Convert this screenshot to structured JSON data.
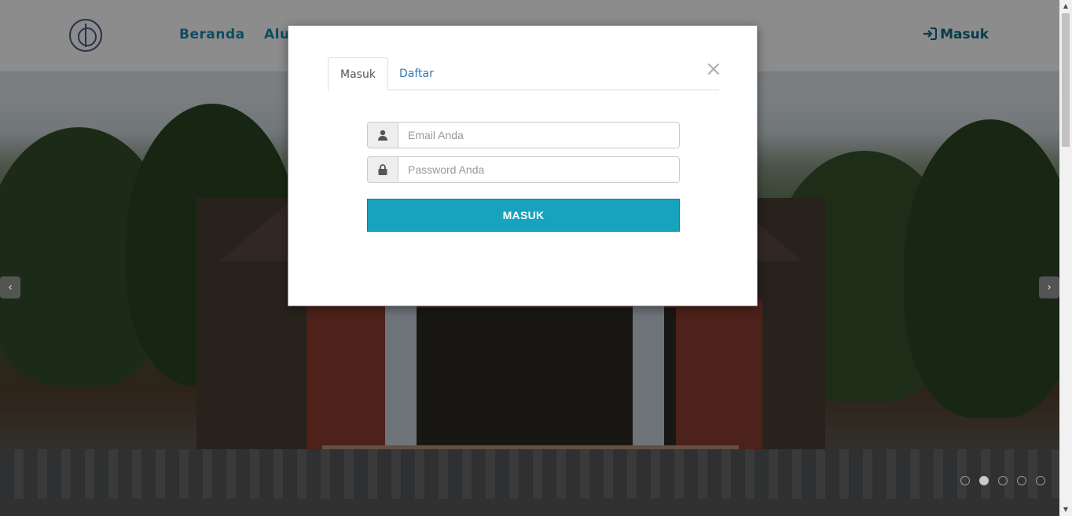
{
  "navbar": {
    "logo_name": "school-logo",
    "links": [
      {
        "label": "Beranda"
      },
      {
        "label": "Alu"
      }
    ],
    "login": {
      "icon": "sign-in-icon",
      "label": "Masuk"
    }
  },
  "carousel": {
    "prev_icon": "chevron-left-icon",
    "next_icon": "chevron-right-icon",
    "prev_glyph": "‹",
    "next_glyph": "›",
    "indicators": 5,
    "active_indicator": 2
  },
  "modal": {
    "close_glyph": "×",
    "tabs": [
      {
        "label": "Masuk",
        "active": true
      },
      {
        "label": "Daftar",
        "active": false
      }
    ],
    "email": {
      "placeholder": "Email Anda",
      "value": "",
      "icon": "user-icon"
    },
    "password": {
      "placeholder": "Password Anda",
      "value": "",
      "icon": "lock-icon"
    },
    "submit_label": "MASUK"
  },
  "colors": {
    "accent": "#17a2bd",
    "nav_link": "#1a8bb0",
    "tab_link": "#337ab7"
  }
}
